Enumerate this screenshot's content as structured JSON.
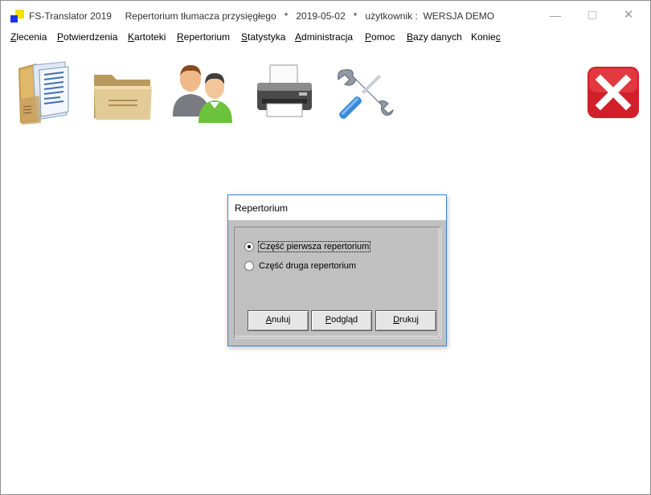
{
  "window": {
    "app_name": "FS-Translator 2019",
    "title_rest": "Repertorium tłumacza przysięgłego   *   2019-05-02   *   użytkownik :  WERSJA DEMO"
  },
  "menu": [
    {
      "first": "Z",
      "rest": "lecenia"
    },
    {
      "first": "P",
      "rest": "otwierdzenia"
    },
    {
      "first": "K",
      "rest": "artoteki"
    },
    {
      "first": "R",
      "rest": "epertorium"
    },
    {
      "first": "S",
      "rest": "tatystyka"
    },
    {
      "first": "A",
      "rest": "dministracja"
    },
    {
      "first": "P",
      "rest": "omoc"
    },
    {
      "first": "B",
      "rest": "azy danych"
    },
    {
      "first": "Konie",
      "rest": "c",
      "underline_last": true
    }
  ],
  "toolbar": {
    "icons": [
      "documents-icon",
      "folder-icon",
      "users-icon",
      "printer-icon",
      "tools-icon",
      "exit-icon"
    ]
  },
  "dialog": {
    "title": "Repertorium",
    "options": [
      {
        "label": "Część pierwsza repertorium",
        "checked": true
      },
      {
        "label": "Część druga repertorium",
        "checked": false
      }
    ],
    "buttons": {
      "cancel": {
        "first": "A",
        "rest": "nuluj"
      },
      "preview": {
        "first": "P",
        "rest": "odgląd"
      },
      "print": {
        "first": "D",
        "rest": "rukuj"
      }
    }
  },
  "colors": {
    "dialog_border": "#3a86d6",
    "dialog_bg": "#c0c0c0",
    "exit_red": "#e0262e"
  }
}
